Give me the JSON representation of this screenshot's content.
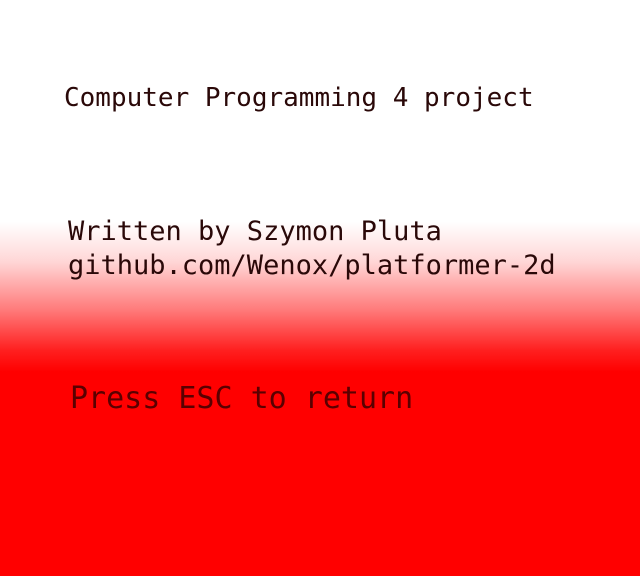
{
  "screen": {
    "title": "Computer Programming 4 project",
    "author_line": "Written by Szymon Pluta",
    "repo_line": "github.com/Wenox/platformer-2d",
    "prompt": "Press ESC to return"
  },
  "colors": {
    "top_background": "#ffffff",
    "bottom_background": "#ff0000",
    "text": "#2a0808",
    "prompt_text": "#5a0000"
  }
}
